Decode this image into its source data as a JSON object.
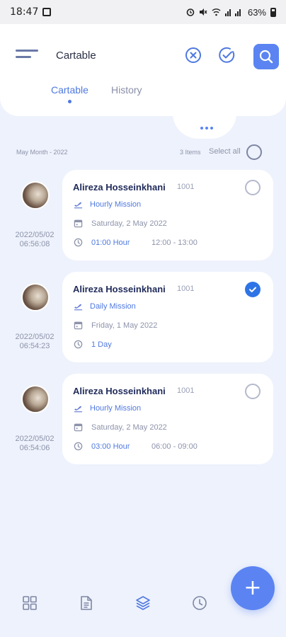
{
  "status_bar": {
    "time": "18:47",
    "battery": "63%",
    "icons": [
      "gallery-icon",
      "alarm-icon",
      "mute-icon",
      "wifi-icon",
      "signal-icon",
      "battery-icon"
    ]
  },
  "header": {
    "title": "Cartable",
    "tabs": [
      {
        "label": "Cartable",
        "active": true
      },
      {
        "label": "History",
        "active": false
      }
    ],
    "buttons": [
      "menu-icon",
      "cancel-icon",
      "approve-icon",
      "search-icon"
    ]
  },
  "filter": {
    "period": "May Month - 2022",
    "count": "3 Items",
    "select_all": "Select all"
  },
  "items": [
    {
      "name": "Alireza Hosseinkhani",
      "code": "1001",
      "mission": "Hourly Mission",
      "date": "Saturday, 2 May 2022",
      "duration": "01:00 Hour",
      "range": "12:00 - 13:00",
      "submitted_date": "2022/05/02",
      "submitted_time": "06:56:08",
      "checked": false
    },
    {
      "name": "Alireza Hosseinkhani",
      "code": "1001",
      "mission": "Daily Mission",
      "date": "Friday, 1 May 2022",
      "duration": "1 Day",
      "range": "",
      "submitted_date": "2022/05/02",
      "submitted_time": "06:54:23",
      "checked": true
    },
    {
      "name": "Alireza Hosseinkhani",
      "code": "1001",
      "mission": "Hourly Mission",
      "date": "Saturday, 2 May 2022",
      "duration": "03:00 Hour",
      "range": "06:00 - 09:00",
      "submitted_date": "2022/05/02",
      "submitted_time": "06:54:06",
      "checked": false
    }
  ],
  "bottom_nav": {
    "items": [
      "dashboard-icon",
      "document-icon",
      "layers-icon",
      "clock-icon"
    ],
    "fab": "+"
  },
  "colors": {
    "accent": "#5b84f2",
    "link": "#4f79e0",
    "checked": "#2f74e6",
    "background": "#eef2fc",
    "text_dark": "#1f2a5a",
    "text_muted": "#8d93ab"
  }
}
